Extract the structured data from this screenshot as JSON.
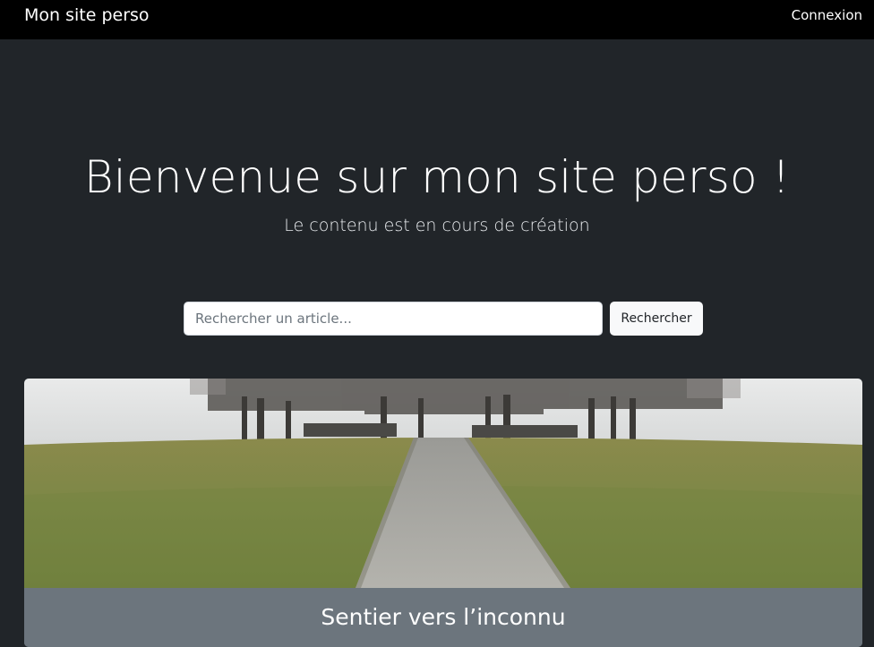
{
  "navbar": {
    "brand": "Mon site perso",
    "login_link": "Connexion"
  },
  "hero": {
    "title": "Bienvenue sur mon site perso !",
    "subtitle": "Le contenu est en cours de création"
  },
  "search": {
    "placeholder": "Rechercher un article...",
    "value": "",
    "button_label": "Rechercher"
  },
  "articles": [
    {
      "title": "Sentier vers l’inconnu",
      "image": "photo of a gravel path through a grassy field toward bare trees"
    }
  ],
  "colors": {
    "page_background": "#212529",
    "navbar_background": "#000000",
    "card_background": "#6c757d",
    "text": "#ffffff"
  }
}
